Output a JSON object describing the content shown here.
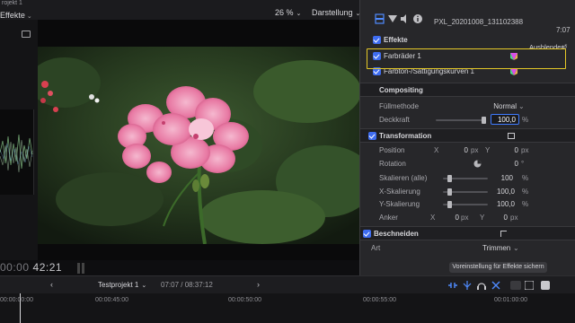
{
  "topbar": {
    "window_title": "rojekt 1",
    "effects_menu": "Effekte",
    "zoom": "26 %",
    "view_menu": "Darstellung"
  },
  "inspector": {
    "clip_name": "PXL_20201008_131102388",
    "clip_time": "7:07",
    "effects": {
      "header": "Effekte",
      "hide_label": "Ausblenden",
      "items": [
        {
          "label": "Farbräder 1"
        },
        {
          "label": "Farbton-/Sättigungskurven 1"
        }
      ]
    },
    "compositing": {
      "header": "Compositing",
      "blend_label": "Füllmethode",
      "blend_value": "Normal",
      "opacity_label": "Deckkraft",
      "opacity_value": "100,0",
      "opacity_unit": "%"
    },
    "transform": {
      "header": "Transformation",
      "position_label": "Position",
      "position_x": "0",
      "position_y": "0",
      "rotation_label": "Rotation",
      "rotation_value": "0",
      "rotation_unit": "°",
      "scale_all_label": "Skalieren (alle)",
      "scale_all_value": "100",
      "scale_x_label": "X-Skalierung",
      "scale_x_value": "100,0",
      "scale_y_label": "Y-Skalierung",
      "scale_y_value": "100,0",
      "anchor_label": "Anker",
      "anchor_x": "0",
      "anchor_y": "0",
      "axis_x": "X",
      "axis_y": "Y",
      "px_unit": "px",
      "pct_unit": "%"
    },
    "crop": {
      "header": "Beschneiden",
      "type_label": "Art",
      "type_value": "Trimmen"
    },
    "preset_button": "Voreinstellung für Effekte sichern"
  },
  "viewer": {
    "timecode_dim": "00:00",
    "timecode": "42:21"
  },
  "timeline": {
    "project": "Testprojekt 1",
    "project_time": "07:07 / 08:37:12",
    "ruler": [
      "00:00:00:00",
      "00:00:45:00",
      "00:00:50:00",
      "00:00:55:00",
      "00:01:00:00"
    ]
  },
  "colors": {
    "accent_blue": "#3e6cf0",
    "selection_yellow": "#e6c928",
    "inspector_bg": "#27272a"
  },
  "icons": [
    "film-icon",
    "filter-icon",
    "audio-icon",
    "info-icon",
    "grid-icon",
    "list-icon",
    "fullscreen-icon",
    "toggle-icon"
  ]
}
